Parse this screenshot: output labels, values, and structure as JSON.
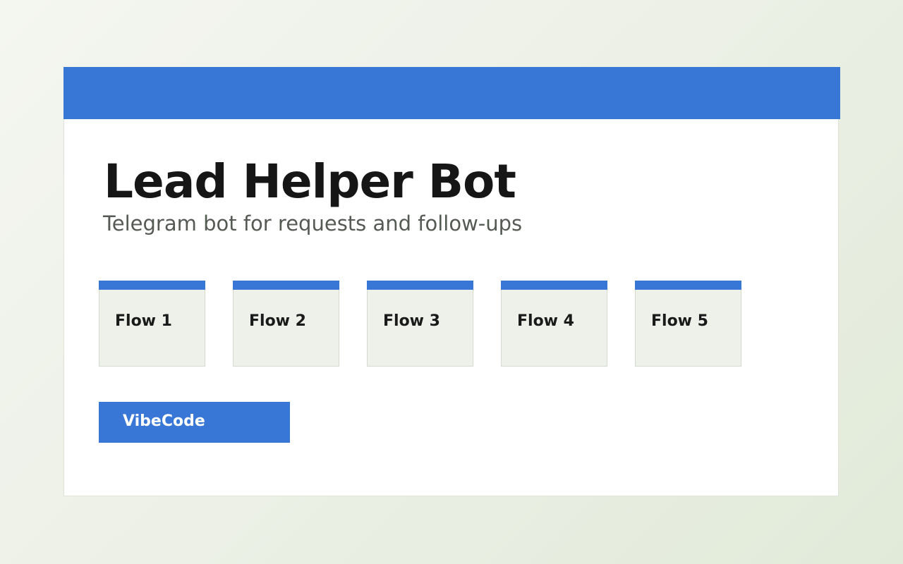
{
  "app": {
    "title": "Lead Helper Bot",
    "subtitle": "Telegram bot for requests and follow-ups"
  },
  "flows": [
    {
      "label": "Flow 1"
    },
    {
      "label": "Flow 2"
    },
    {
      "label": "Flow 3"
    },
    {
      "label": "Flow 4"
    },
    {
      "label": "Flow 5"
    }
  ],
  "brand_button": {
    "label": "VibeCode"
  },
  "colors": {
    "accent": "#3877d6",
    "card_background": "#eef1ea",
    "title_text": "#161616",
    "subtitle_text": "#555a55",
    "page_background": "#ecf0e6"
  }
}
